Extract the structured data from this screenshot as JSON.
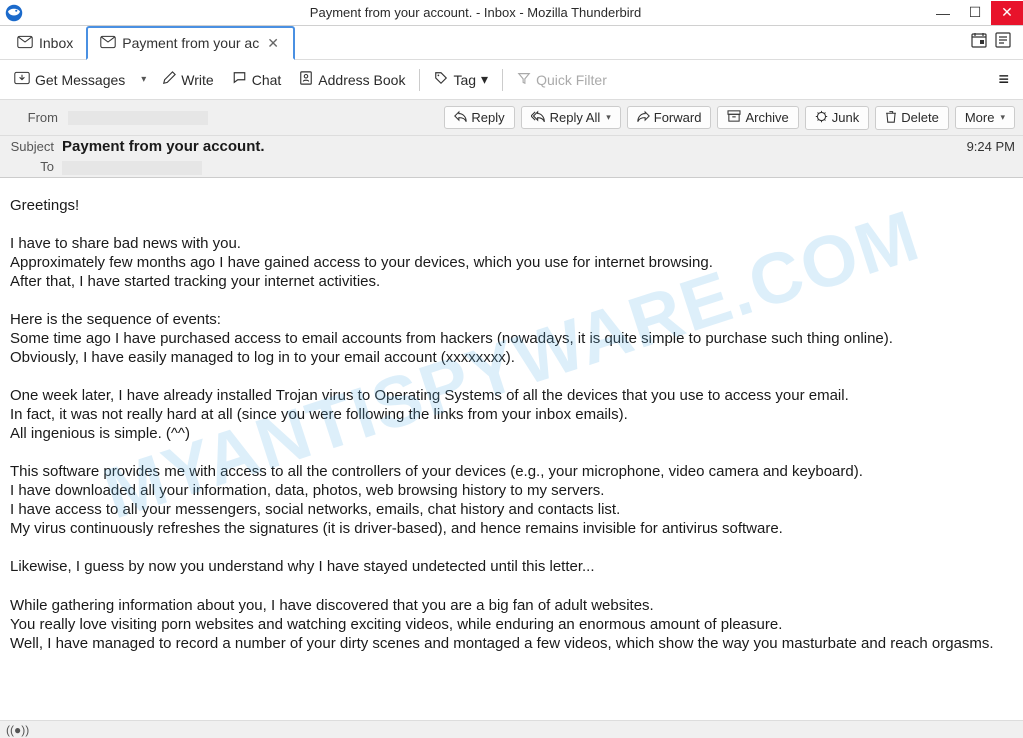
{
  "window_title": "Payment from your account. - Inbox - Mozilla Thunderbird",
  "tabs": {
    "inbox": "Inbox",
    "active": "Payment from your ac"
  },
  "toolbar": {
    "get_messages": "Get Messages",
    "write": "Write",
    "chat": "Chat",
    "address_book": "Address Book",
    "tag": "Tag",
    "quick_filter": "Quick Filter"
  },
  "header": {
    "from_label": "From",
    "from_value": "",
    "subject_label": "Subject",
    "subject_value": "Payment from your account.",
    "to_label": "To",
    "to_value": "",
    "time": "9:24 PM"
  },
  "actions": {
    "reply": "Reply",
    "reply_all": "Reply All",
    "forward": "Forward",
    "archive": "Archive",
    "junk": "Junk",
    "delete": "Delete",
    "more": "More"
  },
  "body": "Greetings!\n\nI have to share bad news with you.\nApproximately few months ago I have gained access to your devices, which you use for internet browsing.\nAfter that, I have started tracking your internet activities.\n\nHere is the sequence of events:\nSome time ago I have purchased access to email accounts from hackers (nowadays, it is quite simple to purchase such thing online).\nObviously, I have easily managed to log in to your email account (xxxxxxxx).\n\nOne week later, I have already installed Trojan virus to Operating Systems of all the devices that you use to access your email.\nIn fact, it was not really hard at all (since you were following the links from your inbox emails).\nAll ingenious is simple. (^^)\n\nThis software provides me with access to all the controllers of your devices (e.g., your microphone, video camera and keyboard).\nI have downloaded all your information, data, photos, web browsing history to my servers.\nI have access to all your messengers, social networks, emails, chat history and contacts list.\nMy virus continuously refreshes the signatures (it is driver-based), and hence remains invisible for antivirus software.\n\nLikewise, I guess by now you understand why I have stayed undetected until this letter...\n\nWhile gathering information about you, I have discovered that you are a big fan of adult websites.\nYou really love visiting porn websites and watching exciting videos, while enduring an enormous amount of pleasure.\nWell, I have managed to record a number of your dirty scenes and montaged a few videos, which show the way you masturbate and reach orgasms.",
  "watermark": "MYANTISPYWARE.COM"
}
